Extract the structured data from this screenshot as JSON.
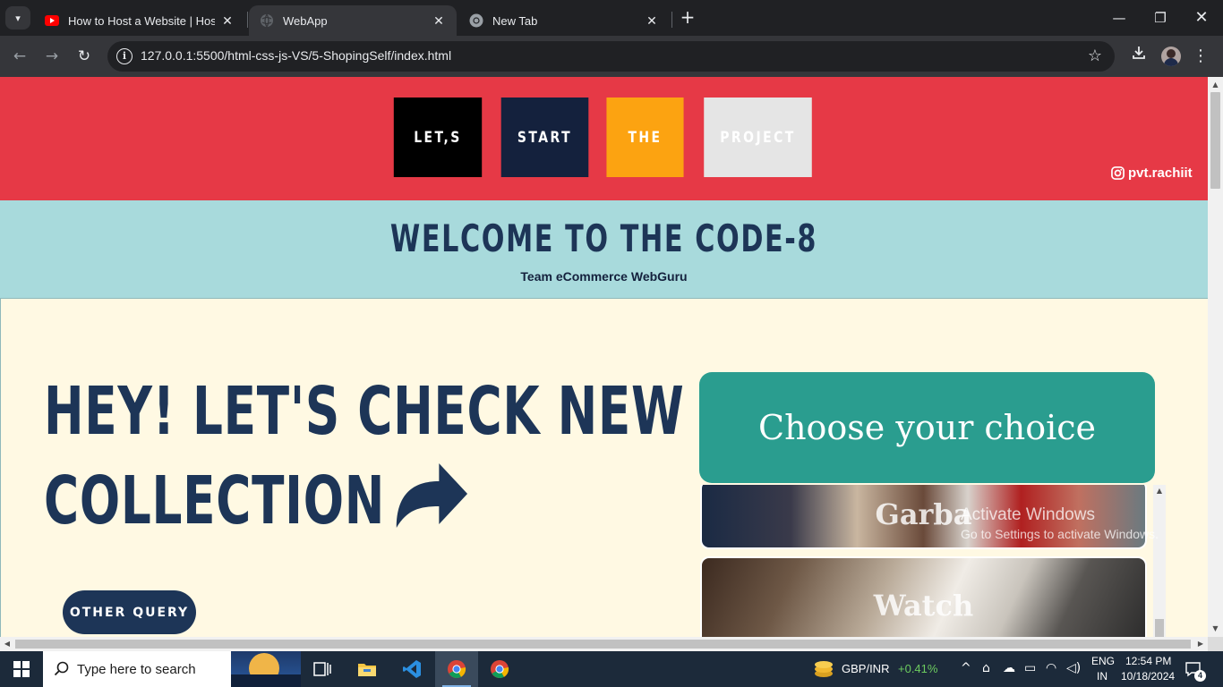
{
  "browser": {
    "tabs": [
      {
        "title": "How to Host a Website | Hosting",
        "icon": "youtube-icon"
      },
      {
        "title": "WebApp",
        "icon": "globe-icon"
      },
      {
        "title": "New Tab",
        "icon": "chrome-icon"
      }
    ],
    "url": "127.0.0.1:5500/html-css-js-VS/5-ShopingSelf/index.html"
  },
  "page": {
    "nav": [
      "LET,S",
      "START",
      "THE",
      "PROJECT"
    ],
    "instagram_handle": "pvt.rachiit",
    "welcome_title": "WELCOME TO THE CODE-8",
    "welcome_subtitle": "Team eCommerce WebGuru",
    "hero_line1": "HEY! LET'S CHECK NEW",
    "hero_line2": "COLLECTION",
    "query_button": "OTHER QUERY",
    "choice_title": "Choose your choice",
    "choices": [
      "Garba",
      "Watch"
    ]
  },
  "watermark": {
    "line1": "Activate Windows",
    "line2": "Go to Settings to activate Windows."
  },
  "taskbar": {
    "search_placeholder": "Type here to search",
    "currency_pair": "GBP/INR",
    "currency_change": "+0.41%",
    "language": "ENG",
    "region": "IN",
    "time": "12:54 PM",
    "date": "10/18/2024",
    "notifications": "4"
  },
  "colors": {
    "header": "#e63946",
    "welcome_bg": "#a8dadc",
    "navy": "#1d3557",
    "cream": "#fff9e3",
    "teal": "#2a9d8f",
    "gold": "#fca311"
  }
}
